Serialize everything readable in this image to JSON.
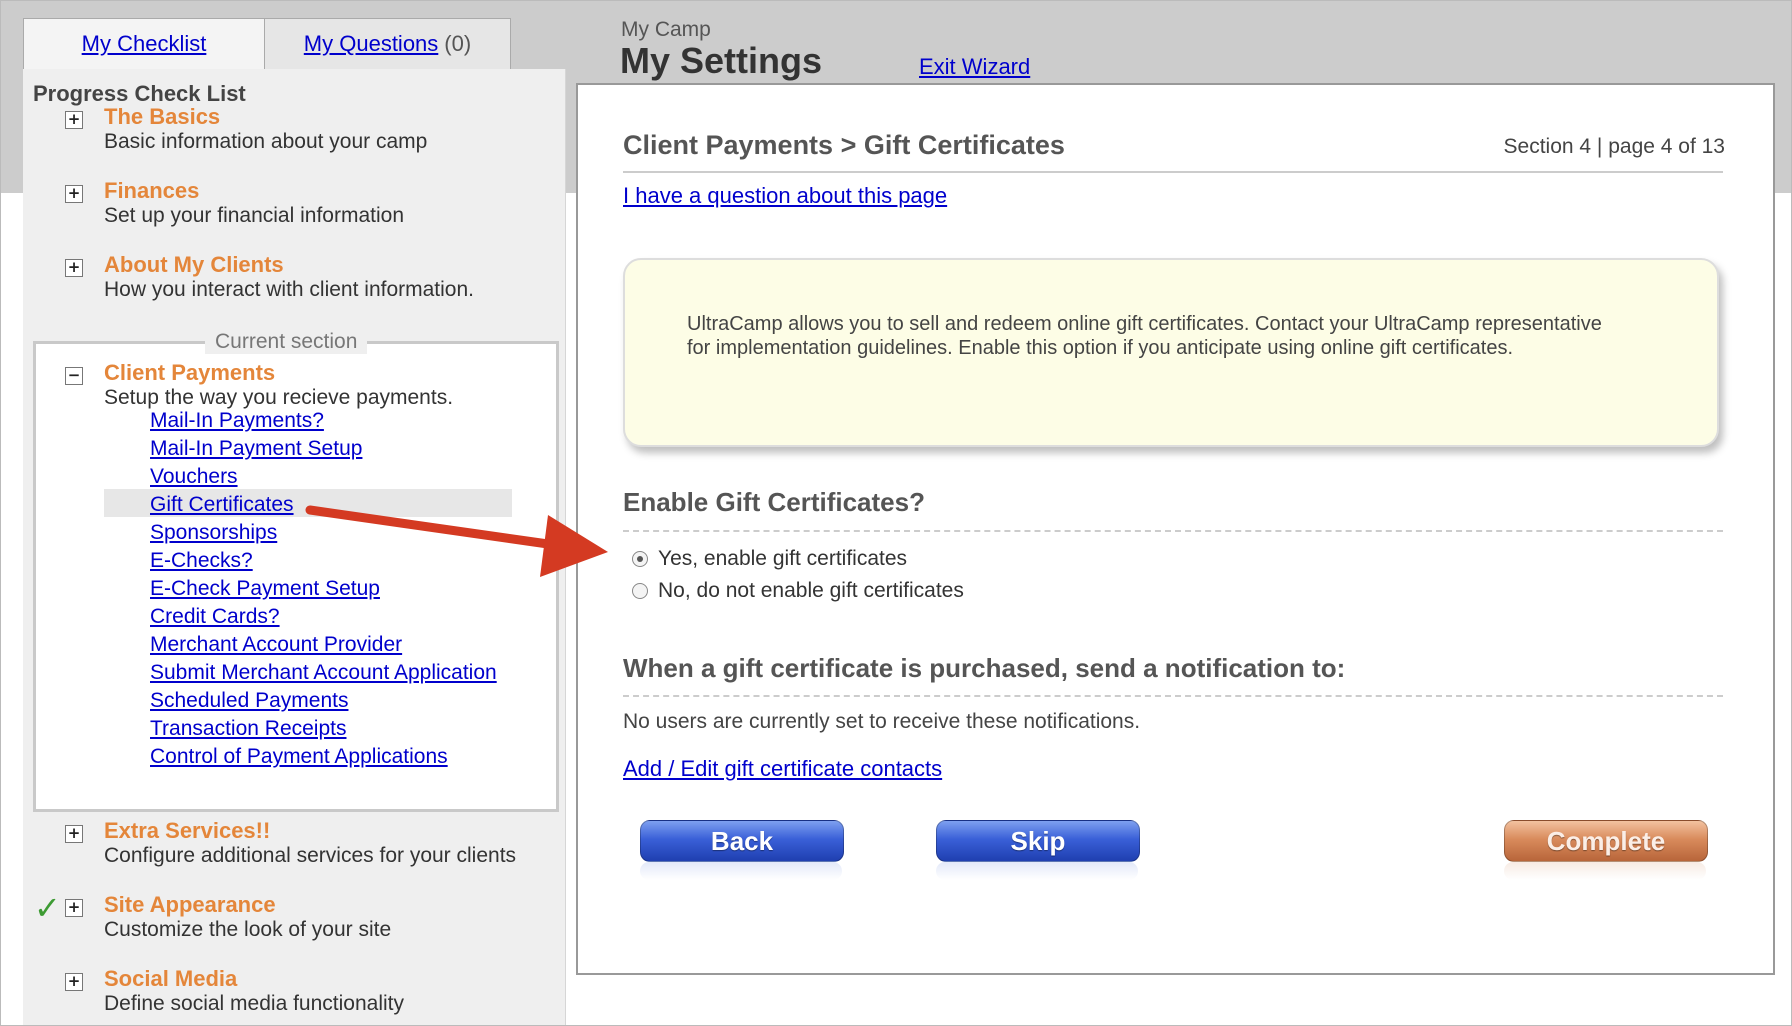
{
  "tabs": {
    "checklist": "My Checklist",
    "questions": "My Questions",
    "questions_count": "(0)"
  },
  "header": {
    "subtitle": "My Camp",
    "title": "My Settings",
    "exit_wizard": "Exit Wizard"
  },
  "sidebar": {
    "title": "Progress Check List",
    "current_section_label": "Current section",
    "sections_before": [
      {
        "name": "The Basics",
        "desc": "Basic information about your camp"
      },
      {
        "name": "Finances",
        "desc": "Set up your financial information"
      },
      {
        "name": "About My Clients",
        "desc": "How you interact with client information."
      }
    ],
    "current": {
      "name": "Client Payments",
      "desc": "Setup the way you recieve payments.",
      "links": [
        "Mail-In Payments?",
        "Mail-In Payment Setup",
        "Vouchers",
        "Gift Certificates",
        "Sponsorships",
        "E-Checks?",
        "E-Check Payment Setup",
        "Credit Cards?",
        "Merchant Account Provider",
        "Submit Merchant Account Application",
        "Scheduled Payments",
        "Transaction Receipts",
        "Control of Payment Applications"
      ],
      "active_link": "Gift Certificates"
    },
    "sections_after": [
      {
        "name": "Extra Services!!",
        "desc": "Configure additional services for your clients"
      },
      {
        "name": "Site Appearance",
        "desc": "Customize the look of your site"
      },
      {
        "name": "Social Media",
        "desc": "Define social media functionality"
      }
    ],
    "plus": "+",
    "minus": "−",
    "checkmark": "✓"
  },
  "main": {
    "breadcrumb": "Client Payments > Gift Certificates",
    "page_info": "Section 4 | page 4 of 13",
    "question_link": "I have a question about this page",
    "info_text": "UltraCamp allows you to sell and redeem online gift certificates. Contact your UltraCamp representative for implementation guidelines. Enable this option if you anticipate using online gift certificates.",
    "enable_title": "Enable Gift Certificates?",
    "options": [
      {
        "label": "Yes, enable gift certificates",
        "selected": true
      },
      {
        "label": "No, do not enable gift certificates",
        "selected": false
      }
    ],
    "notify_title": "When a gift certificate is purchased, send a notification to:",
    "no_users": "No users are currently set to receive these notifications.",
    "add_link": "Add / Edit gift certificate contacts",
    "buttons": {
      "back": "Back",
      "skip": "Skip",
      "complete": "Complete"
    }
  },
  "colors": {
    "section_orange": "#e4863a",
    "link_blue": "#0000cc",
    "arrow_red": "#d43a22",
    "button_blue": "#3a60d8",
    "button_orange": "#d98b5c"
  }
}
